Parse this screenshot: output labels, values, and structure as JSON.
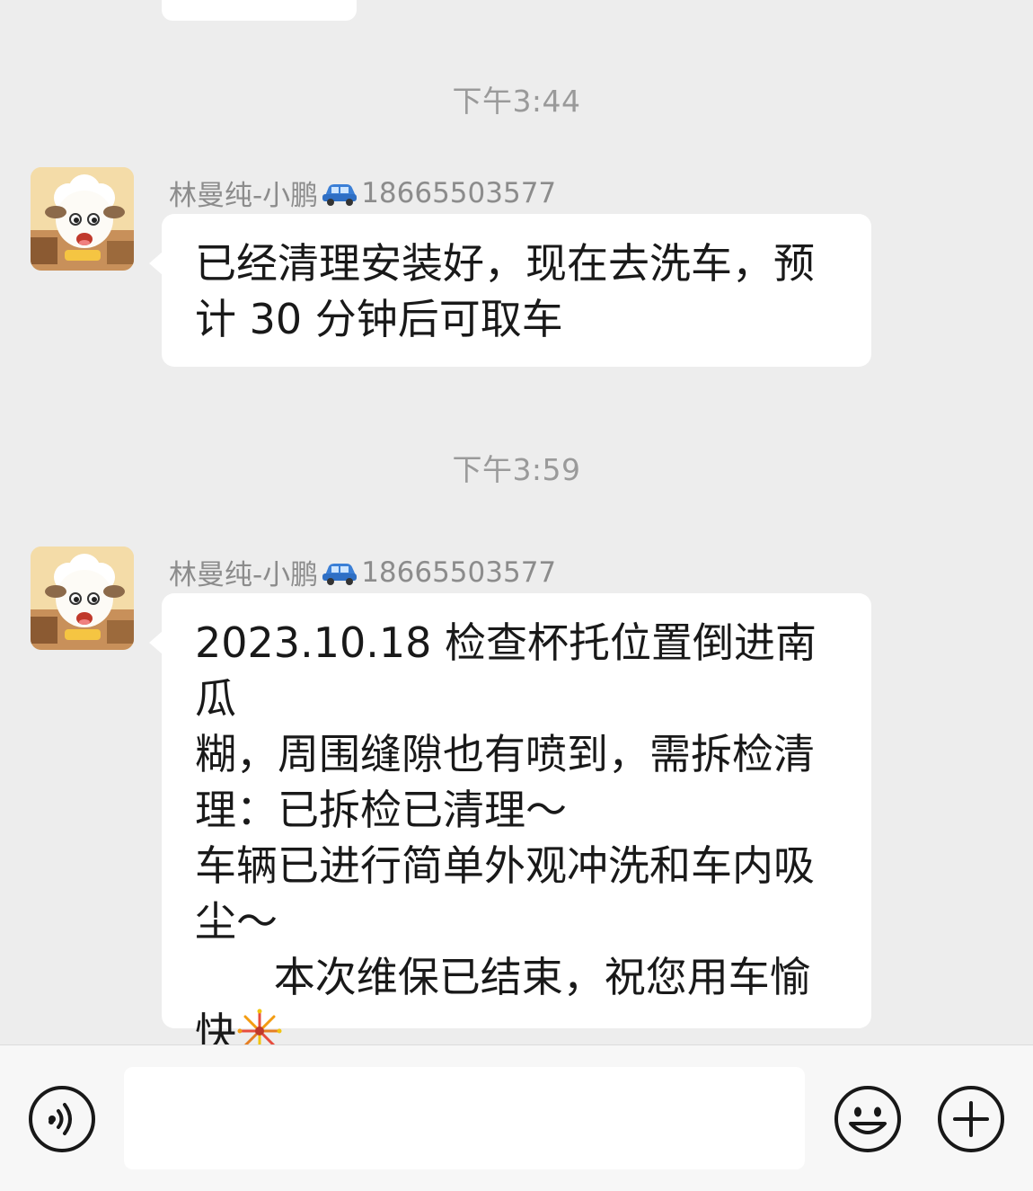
{
  "messages": [
    {
      "timestamp": "下午3:44",
      "sender_name": "林曼纯-小鹏",
      "sender_phone": "18665503577",
      "text": "已经清理安装好，现在去洗车，预\n计 30 分钟后可取车",
      "trailing_emoji": ""
    },
    {
      "timestamp": "下午3:59",
      "sender_name": "林曼纯-小鹏",
      "sender_phone": "18665503577",
      "text": "2023.10.18 检查杯托位置倒进南瓜\n糊，周围缝隙也有喷到，需拆检清\n理：已拆检已清理～\n车辆已进行简单外观冲洗和车内吸\n尘～\n      本次维保已结束，祝您用车愉\n快",
      "trailing_emoji": "fireworks-icon"
    }
  ],
  "input": {
    "value": "",
    "placeholder": ""
  },
  "icons": {
    "sender_badge": "car-icon",
    "voice": "voice-icon",
    "emoji": "emoji-icon",
    "plus": "plus-icon"
  },
  "colors": {
    "chat_background": "#ededed",
    "bubble": "#ffffff",
    "timestamp_text": "#9a9a9a",
    "sender_text": "#8c8c8c",
    "message_text": "#191919",
    "bottom_bar": "#f7f7f7",
    "icon_stroke": "#181818"
  }
}
